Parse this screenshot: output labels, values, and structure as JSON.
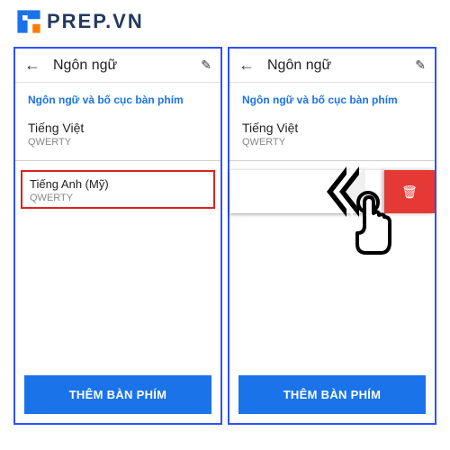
{
  "logo": {
    "text": "PREP.VN"
  },
  "header": {
    "title": "Ngôn ngữ"
  },
  "section_title": "Ngôn ngữ và bố cục bàn phím",
  "languages": {
    "primary": {
      "name": "Tiếng Việt",
      "sub": "QWERTY"
    },
    "secondary": {
      "name": "Tiếng Anh (Mỹ)",
      "sub": "QWERTY"
    }
  },
  "add_button": "THÊM BÀN PHÍM",
  "icons": {
    "back": "←",
    "edit": "✎",
    "trash": "🗑"
  }
}
